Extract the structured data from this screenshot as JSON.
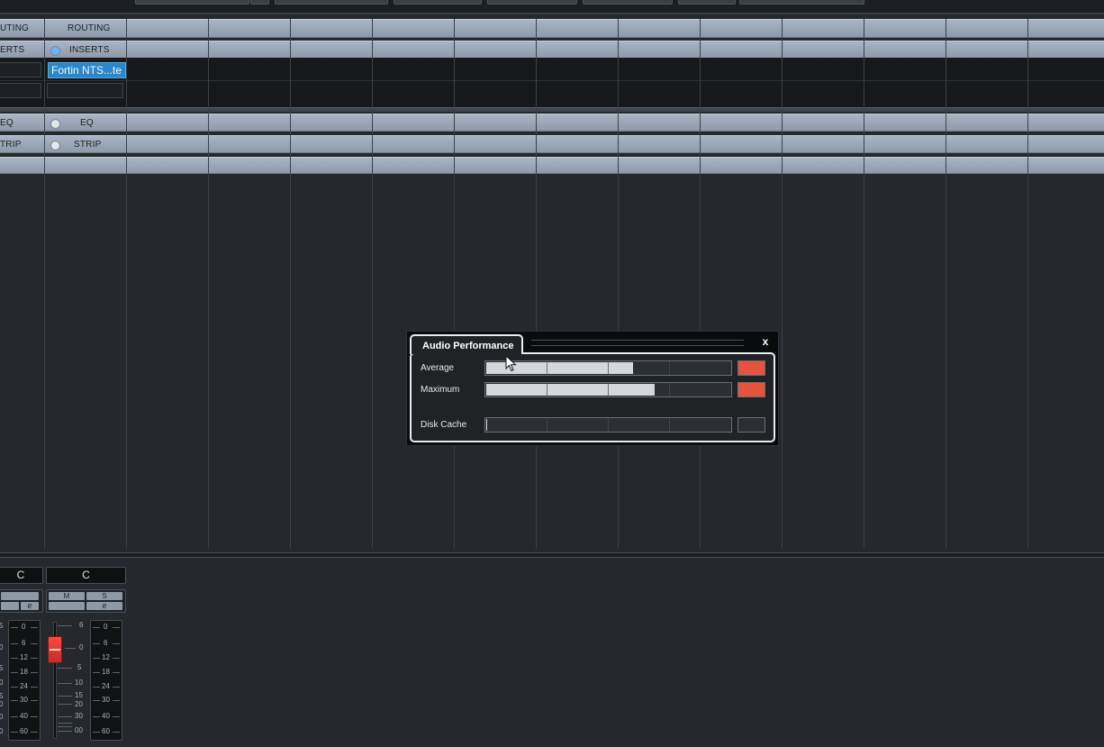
{
  "mixer": {
    "routing_label_left": "UTING",
    "routing_label_right": "ROUTING",
    "inserts_label_left": "ERTS",
    "inserts_label_right": "INSERTS",
    "insert_slot_1": "Fortin NTS...te",
    "eq_label_left": "EQ",
    "eq_label_right": "EQ",
    "strip_label_left": "TRIP",
    "strip_label_right": "STRIP"
  },
  "channel": {
    "pan_left": "C",
    "pan_right": "C",
    "mute_label": "M",
    "solo_label": "S",
    "edit_label": "e",
    "meter_scale": [
      "0",
      "6",
      "12",
      "18",
      "24",
      "30",
      "40",
      "60"
    ],
    "fader_scale": [
      "6",
      "0",
      "5",
      "10",
      "15",
      "20",
      "30",
      "00"
    ],
    "left_meter_partial_scale": [
      "5",
      "0",
      "5",
      "0",
      "5",
      "0",
      "0",
      "0"
    ]
  },
  "audio_performance": {
    "title": "Audio Performance",
    "close_label": "x",
    "average_label": "Average",
    "maximum_label": "Maximum",
    "disk_cache_label": "Disk Cache",
    "average_value": 0.6,
    "maximum_value": 0.69,
    "disk_cache_value": 0.0,
    "overload_color": "#e5533c"
  }
}
